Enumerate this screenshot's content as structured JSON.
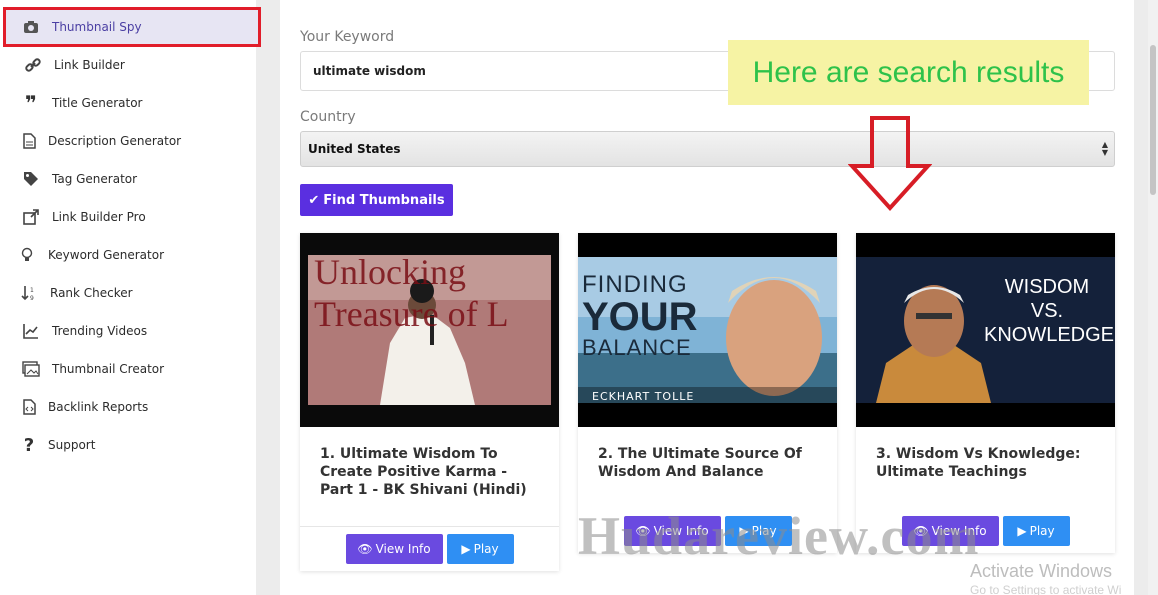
{
  "sidebar": {
    "items": [
      {
        "label": "Thumbnail Spy",
        "icon": "camera-icon"
      },
      {
        "label": "Link Builder",
        "icon": "link-icon"
      },
      {
        "label": "Title Generator",
        "icon": "quote-icon"
      },
      {
        "label": "Description Generator",
        "icon": "document-icon"
      },
      {
        "label": "Tag Generator",
        "icon": "tag-icon"
      },
      {
        "label": "Link Builder Pro",
        "icon": "external-link-icon"
      },
      {
        "label": "Keyword Generator",
        "icon": "lightbulb-icon"
      },
      {
        "label": "Rank Checker",
        "icon": "sort-icon"
      },
      {
        "label": "Trending Videos",
        "icon": "chart-icon"
      },
      {
        "label": "Thumbnail Creator",
        "icon": "images-icon"
      },
      {
        "label": "Backlink Reports",
        "icon": "code-file-icon"
      },
      {
        "label": "Support",
        "icon": "question-icon"
      }
    ]
  },
  "form": {
    "keyword_label": "Your Keyword",
    "keyword_value": "ultimate wisdom",
    "country_label": "Country",
    "country_value": "United States",
    "find_button": "Find Thumbnails"
  },
  "results": [
    {
      "title": "1. Ultimate Wisdom To Create Positive Karma - Part 1 - BK Shivani (Hindi)",
      "thumb_text": "Unlocking Treasure of L"
    },
    {
      "title": "2. The Ultimate Source Of Wisdom And Balance",
      "thumb_line1": "FINDING",
      "thumb_line2": "YOUR",
      "thumb_line3": "BALANCE",
      "thumb_caption": "ECKHART TOLLE"
    },
    {
      "title": "3. Wisdom Vs Knowledge: Ultimate Teachings",
      "thumb_line1": "WISDOM",
      "thumb_line2": "VS.",
      "thumb_line3": "KNOWLEDGE"
    }
  ],
  "buttons": {
    "view_info": "View Info",
    "play": "Play"
  },
  "callout": "Here are search results",
  "watermark": "Hudareview.com",
  "os_notice": {
    "title": "Activate Windows",
    "subtitle": "Go to Settings to activate Wi"
  },
  "colors": {
    "accent": "#5a2fe0",
    "play": "#2f8ff3",
    "highlight_border": "#e11d2a",
    "callout_text": "#2ec24a"
  }
}
